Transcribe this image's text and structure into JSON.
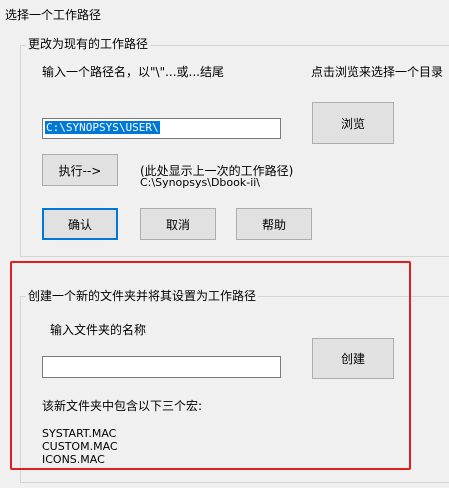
{
  "window": {
    "title": "选择一个工作路径"
  },
  "change_group": {
    "title": "更改为现有的工作路径",
    "input_prompt": "输入一个路径名，以\"\\\"...或...结尾",
    "browse_hint": "点击浏览来选择一个目录",
    "path_value": "C:\\SYNOPSYS\\USER\\",
    "browse_label": "浏览",
    "execute_label": "执行-->",
    "last_path_hint": "(此处显示上一次的工作路径)",
    "last_path_value": "C:\\Synopsys\\Dbook-ii\\",
    "confirm_label": "确认",
    "cancel_label": "取消",
    "help_label": "帮助"
  },
  "create_group": {
    "title": "创建一个新的文件夹并将其设置为工作路径",
    "folder_name_label": "输入文件夹的名称",
    "folder_name_value": "",
    "create_label": "创建",
    "macros_label": "该新文件夹中包含以下三个宏:",
    "macros": [
      "SYSTART.MAC",
      "CUSTOM.MAC",
      "ICONS.MAC"
    ]
  },
  "colors": {
    "highlight_box": "#e02020",
    "selection": "#0078d7"
  }
}
